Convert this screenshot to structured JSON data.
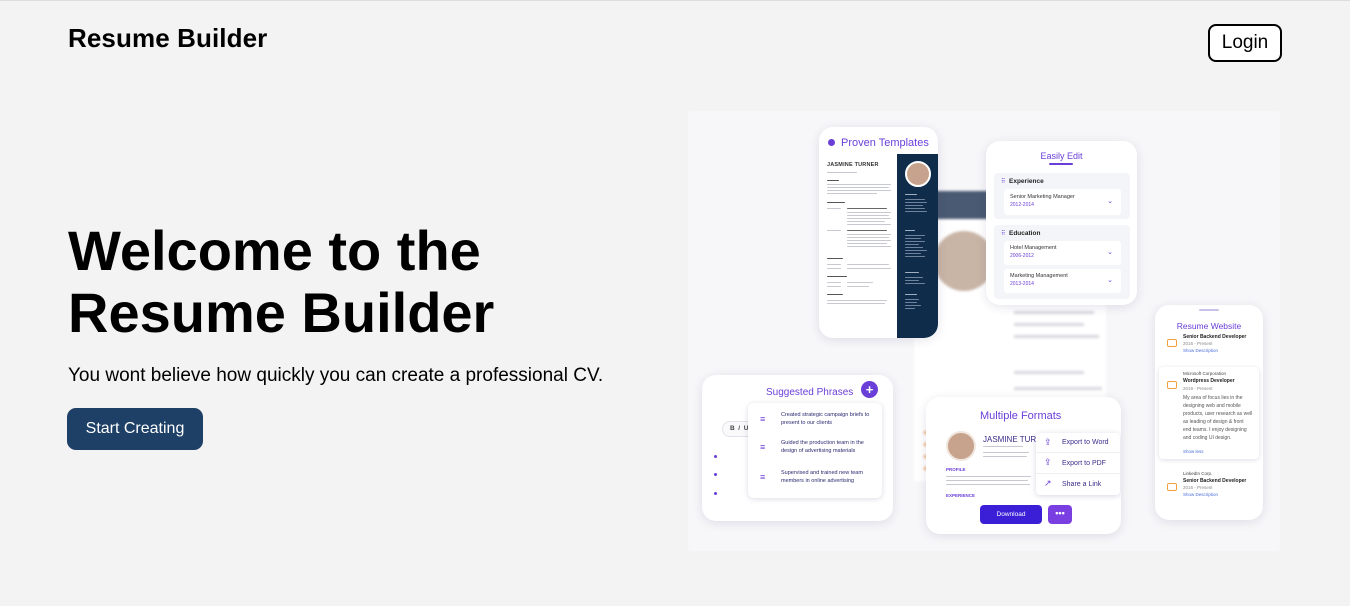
{
  "header": {
    "brand": "Resume Builder",
    "login_label": "Login"
  },
  "hero": {
    "title_line1": "Welcome to the",
    "title_line2": "Resume Builder",
    "subtitle": "You wont believe how quickly you can create a professional CV.",
    "cta_label": "Start Creating"
  },
  "showcase": {
    "proven": {
      "title": "Proven Templates",
      "name": "JASMINE TURNER"
    },
    "easily_edit": {
      "title": "Easily Edit",
      "sections": [
        {
          "heading": "Experience",
          "items": [
            {
              "title": "Senior Marketing Manager",
              "dates": "2012-2014"
            }
          ]
        },
        {
          "heading": "Education",
          "items": [
            {
              "title": "Hotel Management",
              "dates": "2006-2012"
            },
            {
              "title": "Marketing Management",
              "dates": "2013-2014"
            }
          ]
        }
      ]
    },
    "resume_website": {
      "title": "Resume Website",
      "jobs": [
        {
          "company": "",
          "role": "Senior Backend Developer",
          "dates": "2016 - Present",
          "link": "Show Description"
        },
        {
          "company": "Microsoft Corporation",
          "role": "Wordpress Developer",
          "dates": "2019 - Present",
          "desc": "My area of focus lies in the designing web and mobile products, user research as well as leading of design & front end teams. I enjoy designing and coding UI design.",
          "link": "Show less"
        },
        {
          "company": "LinkedIn Corp.",
          "role": "Senior Backend Developer",
          "dates": "2016 - Present",
          "link": "Show Description"
        }
      ]
    },
    "suggested": {
      "title": "Suggested Phrases",
      "phrases": [
        "Created strategic campaign briefs to present to our clients",
        "Guided the production team in the design of advertising materials",
        "Supervised and trained new team members in online advertising"
      ]
    },
    "formats": {
      "title": "Multiple Formats",
      "name": "JASMINE TURNER",
      "profile_label": "PROFILE",
      "experience_label": "EXPERIENCE",
      "menu": [
        "Export to Word",
        "Export to PDF",
        "Share a Link"
      ],
      "download_label": "Download"
    },
    "colors": {
      "accent": "#6a3fd8",
      "navy": "#0f2d4a",
      "cta": "#1e3f66"
    }
  }
}
